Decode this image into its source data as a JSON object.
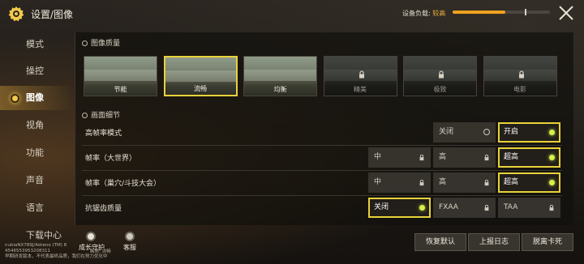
{
  "header": {
    "title": "设置/图像",
    "load_label": "设备负载:",
    "load_value": "较高",
    "load_level": 0.54
  },
  "sidebar": {
    "items": [
      {
        "label": "模式",
        "active": false
      },
      {
        "label": "操控",
        "active": false
      },
      {
        "label": "图像",
        "active": true
      },
      {
        "label": "视角",
        "active": false
      },
      {
        "label": "功能",
        "active": false
      },
      {
        "label": "声音",
        "active": false
      },
      {
        "label": "语言",
        "active": false
      },
      {
        "label": "下载中心",
        "active": false
      }
    ]
  },
  "quality": {
    "section_title": "图像质量",
    "presets": [
      {
        "label": "节能",
        "locked": false,
        "selected": false
      },
      {
        "label": "流畅",
        "locked": false,
        "selected": true
      },
      {
        "label": "均衡",
        "locked": false,
        "selected": false
      },
      {
        "label": "精美",
        "locked": true,
        "selected": false
      },
      {
        "label": "极致",
        "locked": true,
        "selected": false
      },
      {
        "label": "电影",
        "locked": true,
        "selected": false
      }
    ]
  },
  "details": {
    "section_title": "画面细节",
    "rows": [
      {
        "label": "高帧率模式",
        "options": [
          {
            "label": "关闭",
            "state": "off-ring"
          },
          {
            "label": "开启",
            "state": "on"
          }
        ]
      },
      {
        "label": "帧率（大世界）",
        "options": [
          {
            "label": "中",
            "state": "locked"
          },
          {
            "label": "高",
            "state": "locked"
          },
          {
            "label": "超高",
            "state": "on"
          }
        ]
      },
      {
        "label": "帧率（巢穴/斗技大会）",
        "options": [
          {
            "label": "中",
            "state": "locked"
          },
          {
            "label": "高",
            "state": "locked"
          },
          {
            "label": "超高",
            "state": "on"
          }
        ]
      },
      {
        "label": "抗锯齿质量",
        "options": [
          {
            "label": "关闭",
            "state": "on"
          },
          {
            "label": "FXAA",
            "state": "locked"
          },
          {
            "label": "TAA",
            "state": "locked"
          }
        ]
      }
    ]
  },
  "footer": {
    "device_line1": "nubiaNX789J/Adreno (TM) 8",
    "device_line2": "4546553953208311",
    "device_line3": "早期研发版本，不代表最终品质，我们在努力优化中",
    "growth_guard": "成长守护",
    "customer_service": "客服",
    "quality_note": "画质: 流畅",
    "buttons": [
      "恢复默认",
      "上报日志",
      "脱离卡死"
    ]
  },
  "colors": {
    "accent_yellow": "#e8d23a",
    "load_orange": "#f0a21e",
    "load_value_color": "#f0b43c",
    "on_dot": "#d7f04a"
  }
}
